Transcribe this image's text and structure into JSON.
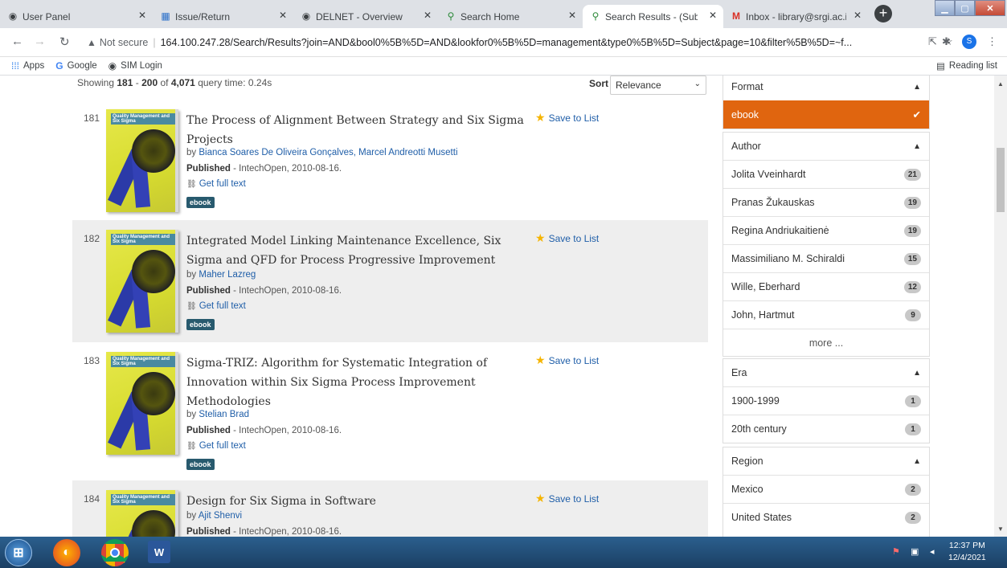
{
  "browser": {
    "tabs": [
      {
        "label": "User Panel",
        "icon": "globe-icon"
      },
      {
        "label": "Issue/Return",
        "icon": "app-icon"
      },
      {
        "label": "DELNET - Overview",
        "icon": "globe-icon"
      },
      {
        "label": "Search Home",
        "icon": "search-icon"
      },
      {
        "label": "Search Results - (Subject",
        "icon": "search-icon"
      },
      {
        "label": "Inbox - library@srgi.ac.in",
        "icon": "gmail-icon"
      }
    ],
    "security_label": "Not secure",
    "url": "164.100.247.28/Search/Results?join=AND&bool0%5B%5D=AND&lookfor0%5B%5D=management&type0%5B%5D=Subject&page=10&filter%5B%5D=~f...",
    "profile_initial": "S",
    "bookmarks": [
      {
        "label": "Apps",
        "icon": "apps-grid-icon"
      },
      {
        "label": "Google",
        "icon": "google-icon"
      },
      {
        "label": "SIM Login",
        "icon": "globe-icon"
      }
    ],
    "reading_list": "Reading list"
  },
  "results_header": {
    "showing_prefix": "Showing",
    "from": "181",
    "dash": "-",
    "to": "200",
    "of": "of",
    "total": "4,071",
    "query_time": "query time: 0.24s",
    "sort_label": "Sort",
    "sort_value": "Relevance"
  },
  "results": [
    {
      "number": "181",
      "title": "The Process of Alignment Between Strategy and Six Sigma Projects",
      "by": "by",
      "author": "Bianca Soares De Oliveira Gonçalves, Marcel Andreotti Musetti",
      "published_label": "Published",
      "published": " - IntechOpen, 2010-08-16.",
      "full_text": "Get full text",
      "format": "ebook",
      "save": "Save to List"
    },
    {
      "number": "182",
      "title": "Integrated Model Linking Maintenance Excellence, Six Sigma and QFD for Process Progressive Improvement",
      "by": "by",
      "author": "Maher Lazreg",
      "published_label": "Published",
      "published": " - IntechOpen, 2010-08-16.",
      "full_text": "Get full text",
      "format": "ebook",
      "save": "Save to List"
    },
    {
      "number": "183",
      "title": "Sigma-TRIZ: Algorithm for Systematic Integration of Innovation within Six Sigma Process Improvement Methodologies",
      "by": "by",
      "author": "Stelian Brad",
      "published_label": "Published",
      "published": " - IntechOpen, 2010-08-16.",
      "full_text": "Get full text",
      "format": "ebook",
      "save": "Save to List"
    },
    {
      "number": "184",
      "title": "Design for Six Sigma in Software",
      "by": "by",
      "author": "Ajit Shenvi",
      "published_label": "Published",
      "published": " - IntechOpen, 2010-08-16.",
      "save": "Save to List"
    }
  ],
  "cover_text": "Quality Management and Six Sigma",
  "facets": {
    "format": {
      "title": "Format",
      "selected": "ebook"
    },
    "author": {
      "title": "Author",
      "items": [
        {
          "label": "Jolita Vveinhardt",
          "count": "21"
        },
        {
          "label": "Pranas Žukauskas",
          "count": "19"
        },
        {
          "label": "Regina Andriukaitienė",
          "count": "19"
        },
        {
          "label": "Massimiliano M. Schiraldi",
          "count": "15"
        },
        {
          "label": "Wille, Eberhard",
          "count": "12"
        },
        {
          "label": "John, Hartmut",
          "count": "9"
        }
      ],
      "more": "more ..."
    },
    "era": {
      "title": "Era",
      "items": [
        {
          "label": "1900-1999",
          "count": "1"
        },
        {
          "label": "20th century",
          "count": "1"
        }
      ]
    },
    "region": {
      "title": "Region",
      "items": [
        {
          "label": "Mexico",
          "count": "2"
        },
        {
          "label": "United States",
          "count": "2"
        }
      ]
    }
  },
  "taskbar": {
    "time": "12:37 PM",
    "date": "12/4/2021"
  },
  "colors": {
    "accent_orange": "#e0650f",
    "link_blue": "#1f5ea8",
    "badge_teal": "#285a6e"
  }
}
